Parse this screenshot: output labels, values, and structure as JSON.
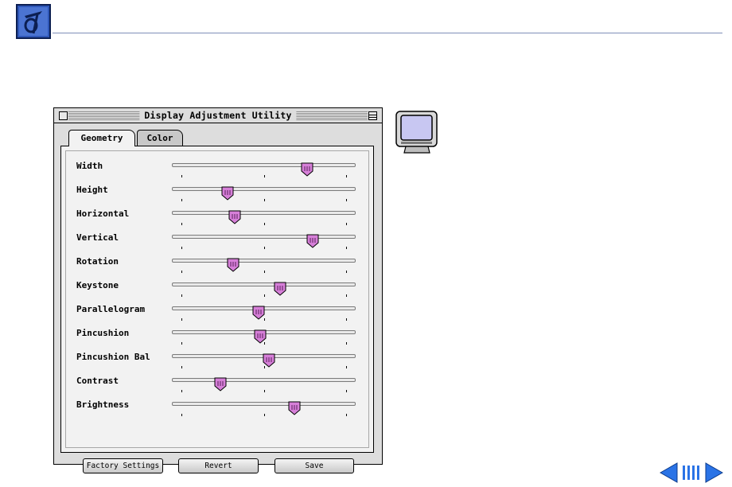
{
  "window": {
    "title": "Display Adjustment Utility",
    "tabs": [
      {
        "label": "Geometry",
        "selected": true
      },
      {
        "label": "Color",
        "selected": false
      }
    ],
    "sliders": [
      {
        "label": "Width",
        "value": 0.74
      },
      {
        "label": "Height",
        "value": 0.3
      },
      {
        "label": "Horizontal",
        "value": 0.34
      },
      {
        "label": "Vertical",
        "value": 0.77
      },
      {
        "label": "Rotation",
        "value": 0.33
      },
      {
        "label": "Keystone",
        "value": 0.59
      },
      {
        "label": "Parallelogram",
        "value": 0.47
      },
      {
        "label": "Pincushion",
        "value": 0.48
      },
      {
        "label": "Pincushion Bal",
        "value": 0.53
      },
      {
        "label": "Contrast",
        "value": 0.26
      },
      {
        "label": "Brightness",
        "value": 0.67
      }
    ],
    "buttons": {
      "factory": "Factory Settings",
      "revert": "Revert",
      "save": "Save"
    }
  },
  "colors": {
    "thumb": "#d67fd8",
    "logo": "#2f57b8",
    "nav": "#2a73e6"
  },
  "icons": [
    "logo-icon",
    "monitor-icon",
    "nav-back-icon",
    "nav-index-icon",
    "nav-forward-icon"
  ]
}
